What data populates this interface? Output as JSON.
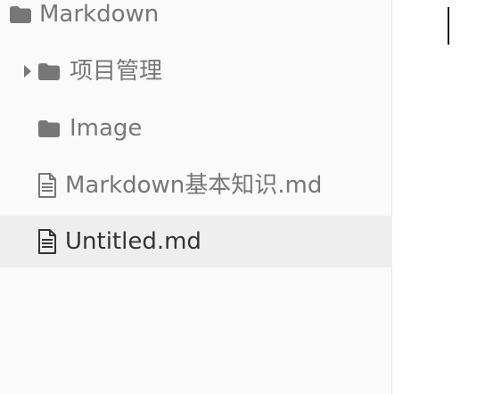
{
  "sidebar": {
    "root": {
      "label": "Markdown",
      "icon": "folder-icon"
    },
    "items": [
      {
        "label": "项目管理",
        "type": "folder",
        "icon": "folder-icon",
        "expanded": false
      },
      {
        "label": "Image",
        "type": "folder",
        "icon": "folder-icon"
      },
      {
        "label": "Markdown基本知识.md",
        "type": "file",
        "icon": "file-text-icon"
      },
      {
        "label": "Untitled.md",
        "type": "file",
        "icon": "file-text-icon",
        "selected": true
      }
    ]
  },
  "colors": {
    "sidebar_background": "#fafafa",
    "selected_row": "#eeeeee",
    "icon": "#777777",
    "text": "#777777",
    "selected_text": "#333333",
    "caret": "#111111"
  }
}
